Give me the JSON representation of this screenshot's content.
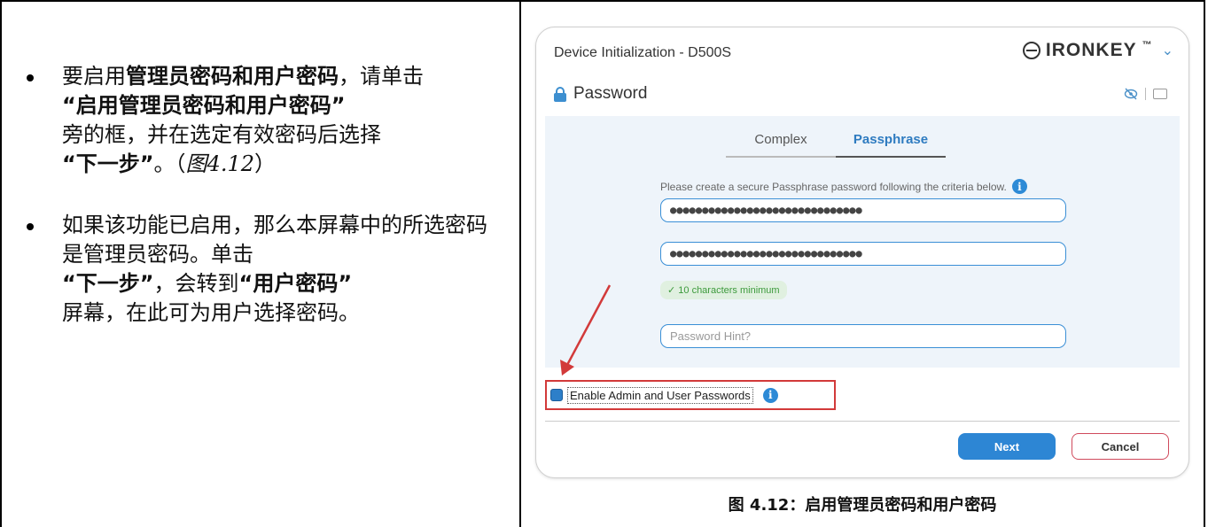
{
  "left": {
    "bullet1": {
      "p1": "要启用",
      "p2_bold": "管理员密码和用户密码",
      "p3": "，请单击",
      "p4_bold": "“启用管理员密码和用户密码”",
      "p5": "旁的框，并在选定有效密码后选择",
      "p6_bold": "“下一步”",
      "p7": "。（",
      "p8_italic": "图4.12",
      "p9": "）"
    },
    "bullet2": {
      "p1": "如果该功能已启用，那么本屏幕中的所选密码是管理员密码。单击",
      "p2_bold": "“下一步”",
      "p3": "，会转到",
      "p4_bold": "“用户密码”",
      "p5": "屏幕，在此可为用户选择密码。"
    }
  },
  "dialog": {
    "title": "Device Initialization - D500S",
    "logo_text": "IRONKEY",
    "logo_mark": "™",
    "chevron": "⌄",
    "section": "Password",
    "tabs": [
      "Complex",
      "Passphrase"
    ],
    "active_tab": "Passphrase",
    "criteria_text": "Please create a secure Passphrase password following the criteria below.",
    "info_glyph": "i",
    "password_mask": "●●●●●●●●●●●●●●●●●●●●●●●●●●●●●●",
    "confirm_mask": "●●●●●●●●●●●●●●●●●●●●●●●●●●●●●●",
    "requirement": "✓ 10 characters minimum",
    "hint_placeholder": "Password Hint?",
    "enable_label": "Enable Admin and User Passwords",
    "next_button": "Next",
    "cancel_button": "Cancel",
    "colors": {
      "accent": "#2d86d4",
      "highlight_box": "#d23a3a",
      "cancel_border": "#d04a5c"
    }
  },
  "caption": "图 4.12：启用管理员密码和用户密码"
}
